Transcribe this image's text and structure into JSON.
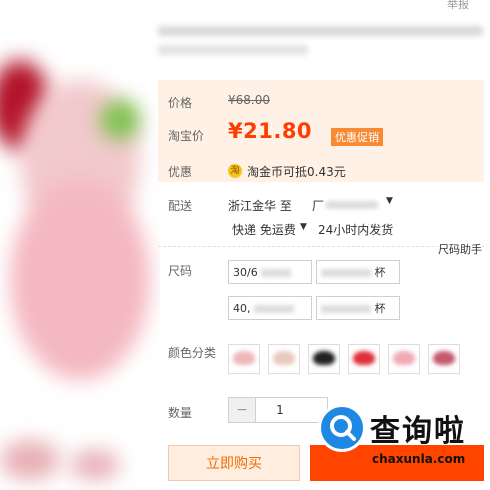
{
  "top": {
    "report_label": "举报"
  },
  "price": {
    "list_label": "价格",
    "list_value": "¥68.00",
    "taobao_label": "淘宝价",
    "taobao_value": "¥21.80",
    "promo_label": "优惠促销"
  },
  "discount": {
    "label": "优惠",
    "coin_icon_text": "淘",
    "text": "淘金币可抵0.43元"
  },
  "delivery": {
    "label": "配送",
    "from": "浙江金华 至",
    "to_prefix": "厂",
    "method": "快递 免运费",
    "ship_time": "24小时内发货"
  },
  "size_helper": "尺码助手",
  "size": {
    "label": "尺码",
    "options": [
      "30/6",
      "杯",
      "40,",
      "杯"
    ]
  },
  "color": {
    "label": "颜色分类"
  },
  "quantity": {
    "label": "数量",
    "minus": "−",
    "value": "1"
  },
  "actions": {
    "buy_now": "立即购买"
  },
  "watermark": {
    "title": "查询啦",
    "url": "chaxunla.com"
  },
  "colors": {
    "accent": "#ff3d00",
    "price_bg": "#fff1e6",
    "promo": "#f88a33",
    "cart": "#ff4400",
    "watermark_blue": "#1e88e5"
  }
}
